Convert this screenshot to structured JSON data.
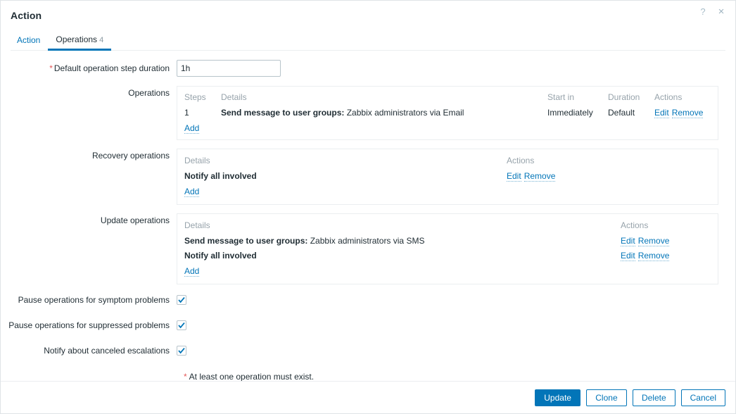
{
  "dialog": {
    "title": "Action",
    "help_icon_label": "?",
    "close_icon_label": "×"
  },
  "tabs": [
    {
      "label": "Action",
      "count": "",
      "active": false
    },
    {
      "label": "Operations",
      "count": "4",
      "active": true
    }
  ],
  "form": {
    "default_step_duration": {
      "label": "Default operation step duration",
      "required_marker": "*",
      "value": "1h",
      "placeholder": ""
    },
    "operations": {
      "label": "Operations",
      "headers": {
        "steps": "Steps",
        "details": "Details",
        "start_in": "Start in",
        "duration": "Duration",
        "actions": "Actions"
      },
      "rows": [
        {
          "steps": "1",
          "details_bold": "Send message to user groups:",
          "details_rest": " Zabbix administrators via Email",
          "start_in": "Immediately",
          "duration": "Default",
          "edit": "Edit",
          "remove": "Remove"
        }
      ],
      "add_label": "Add"
    },
    "recovery_operations": {
      "label": "Recovery operations",
      "headers": {
        "details": "Details",
        "actions": "Actions"
      },
      "rows": [
        {
          "details_bold": "Notify all involved",
          "details_rest": "",
          "edit": "Edit",
          "remove": "Remove"
        }
      ],
      "add_label": "Add"
    },
    "update_operations": {
      "label": "Update operations",
      "headers": {
        "details": "Details",
        "actions": "Actions"
      },
      "rows": [
        {
          "details_bold": "Send message to user groups:",
          "details_rest": " Zabbix administrators via SMS",
          "edit": "Edit",
          "remove": "Remove"
        },
        {
          "details_bold": "Notify all involved",
          "details_rest": "",
          "edit": "Edit",
          "remove": "Remove"
        }
      ],
      "add_label": "Add"
    },
    "checkboxes": [
      {
        "label": "Pause operations for symptom problems",
        "checked": true
      },
      {
        "label": "Pause operations for suppressed problems",
        "checked": true
      },
      {
        "label": "Notify about canceled escalations",
        "checked": true
      }
    ],
    "footnote": {
      "marker": "*",
      "text": "At least one operation must exist."
    }
  },
  "footer": {
    "update_label": "Update",
    "clone_label": "Clone",
    "delete_label": "Delete",
    "cancel_label": "Cancel"
  },
  "colors": {
    "accent": "#0275b8",
    "required": "#e45959",
    "muted": "#97a3ab",
    "text": "#1f2c33",
    "border": "#ebeef0"
  }
}
